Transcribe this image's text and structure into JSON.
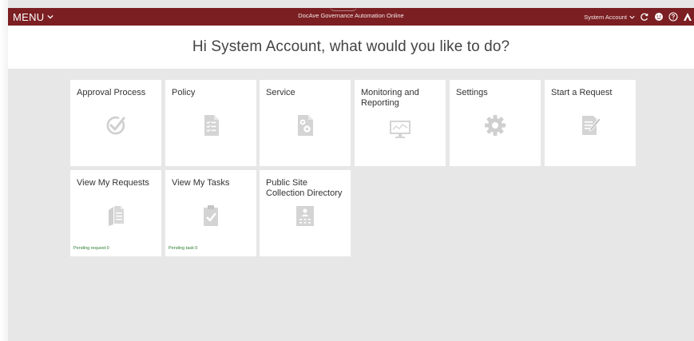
{
  "topbar": {
    "menu_label": "MENU",
    "app_title": "DocAve Governance Automation Online",
    "account_name": "System Account"
  },
  "greeting": "Hi System Account, what would you like to do?",
  "tiles": [
    {
      "label": "Approval Process",
      "icon": "approval-check-icon"
    },
    {
      "label": "Policy",
      "icon": "policy-document-icon"
    },
    {
      "label": "Service",
      "icon": "service-gear-document-icon"
    },
    {
      "label": "Monitoring and Reporting",
      "icon": "monitor-chart-icon"
    },
    {
      "label": "Settings",
      "icon": "gear-icon"
    },
    {
      "label": "Start a Request",
      "icon": "request-edit-icon"
    },
    {
      "label": "View My Requests",
      "icon": "requests-pages-icon",
      "footer": "Pending request:0"
    },
    {
      "label": "View My Tasks",
      "icon": "clipboard-check-icon",
      "footer": "Pending task:0"
    },
    {
      "label": "Public Site Collection Directory",
      "icon": "directory-icon"
    }
  ],
  "colors": {
    "topbar": "#7b1f22",
    "background": "#e7e7e7",
    "tile": "#ffffff",
    "icon_gray": "#cfcfcf",
    "pending_green": "#2e7d32"
  }
}
